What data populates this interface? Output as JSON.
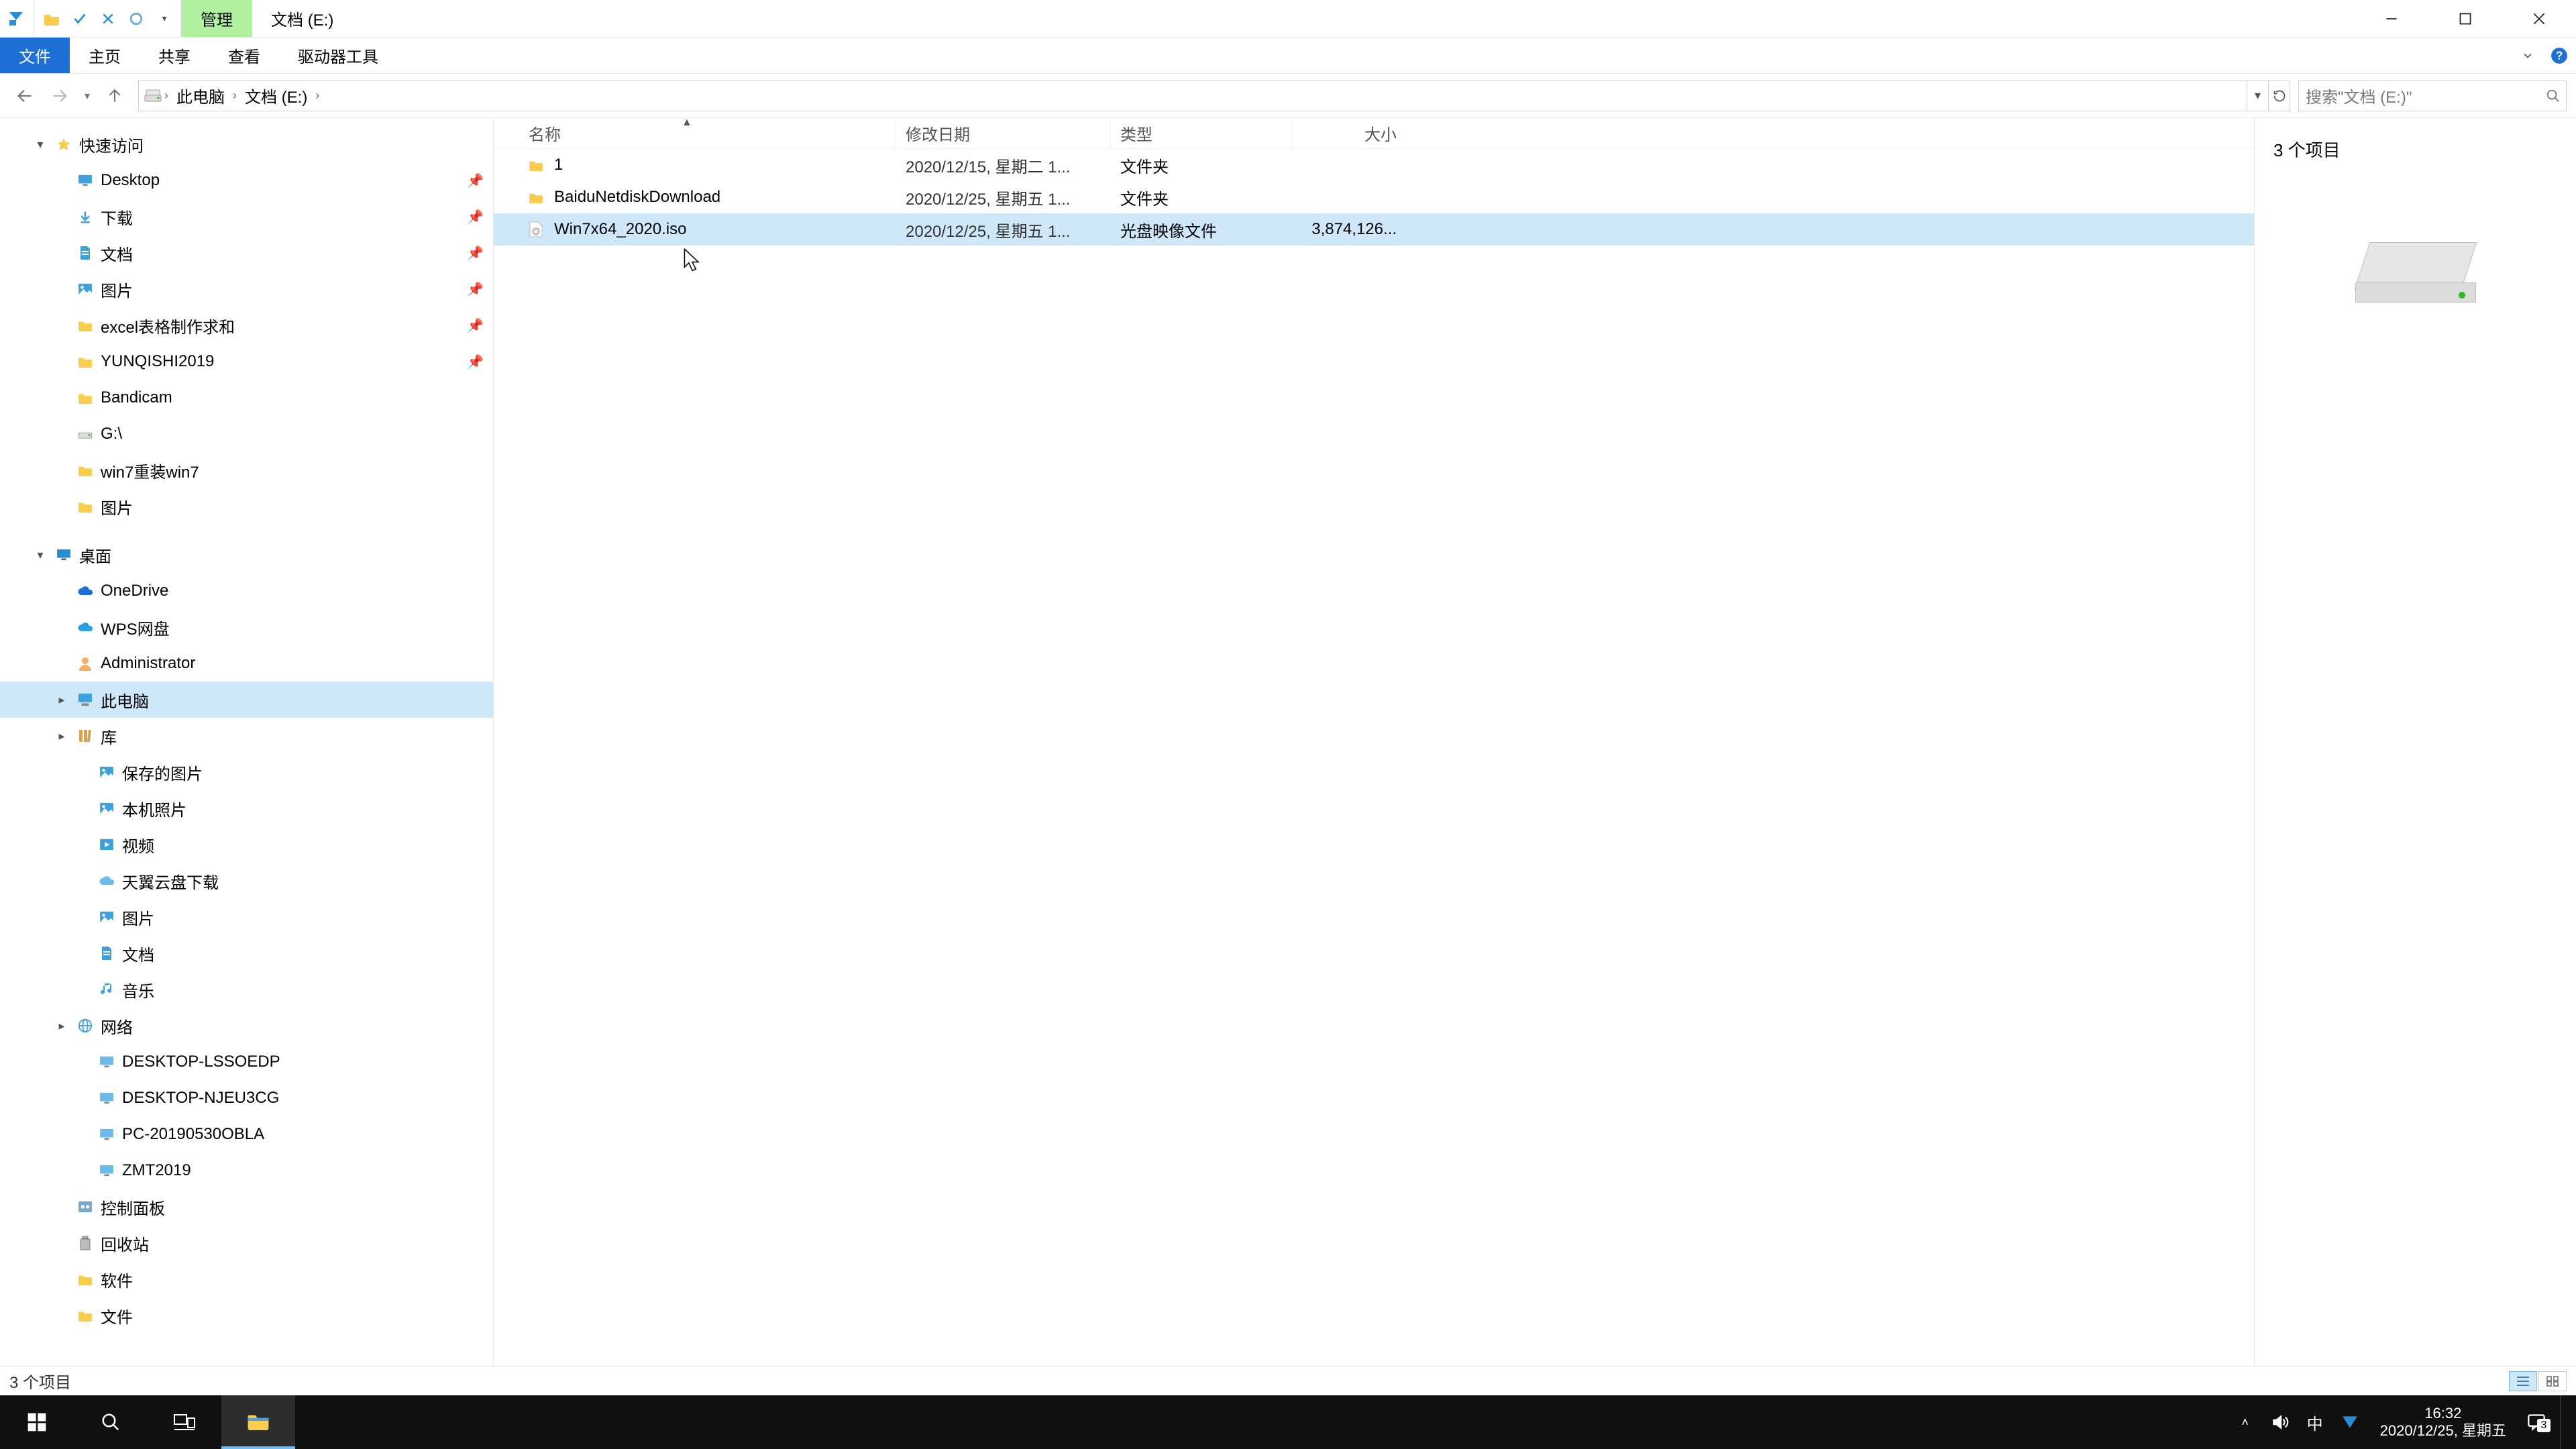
{
  "titlebar": {
    "context_tab": "管理",
    "location_tab": "文档 (E:)"
  },
  "ribbon": {
    "file": "文件",
    "home": "主页",
    "share": "共享",
    "view": "查看",
    "drive_tools": "驱动器工具"
  },
  "breadcrumb": {
    "segs": [
      "此电脑",
      "文档 (E:)"
    ]
  },
  "search": {
    "placeholder": "搜索\"文档 (E:)\""
  },
  "tree": {
    "items": [
      {
        "label": "快速访问",
        "indent": 0,
        "caret": "▾",
        "icon": "star"
      },
      {
        "label": "Desktop",
        "indent": 1,
        "icon": "desktop",
        "pin": true
      },
      {
        "label": "下载",
        "indent": 1,
        "icon": "download",
        "pin": true
      },
      {
        "label": "文档",
        "indent": 1,
        "icon": "doc",
        "pin": true
      },
      {
        "label": "图片",
        "indent": 1,
        "icon": "pic",
        "pin": true
      },
      {
        "label": "excel表格制作求和",
        "indent": 1,
        "icon": "folder",
        "pin": true
      },
      {
        "label": "YUNQISHI2019",
        "indent": 1,
        "icon": "folder",
        "pin": true
      },
      {
        "label": "Bandicam",
        "indent": 1,
        "icon": "folder"
      },
      {
        "label": "G:\\",
        "indent": 1,
        "icon": "drive"
      },
      {
        "label": "win7重装win7",
        "indent": 1,
        "icon": "folder"
      },
      {
        "label": "图片",
        "indent": 1,
        "icon": "folder"
      },
      {
        "label": "桌面",
        "indent": 0,
        "caret": "▾",
        "icon": "desktop-blue",
        "spaceBefore": true
      },
      {
        "label": "OneDrive",
        "indent": 1,
        "icon": "onedrive"
      },
      {
        "label": "WPS网盘",
        "indent": 1,
        "icon": "wps"
      },
      {
        "label": "Administrator",
        "indent": 1,
        "icon": "user"
      },
      {
        "label": "此电脑",
        "indent": 1,
        "icon": "pc",
        "active": true,
        "caret": "▸"
      },
      {
        "label": "库",
        "indent": 1,
        "icon": "lib",
        "caret": "▸"
      },
      {
        "label": "保存的图片",
        "indent": 2,
        "icon": "pic"
      },
      {
        "label": "本机照片",
        "indent": 2,
        "icon": "pic"
      },
      {
        "label": "视频",
        "indent": 2,
        "icon": "video"
      },
      {
        "label": "天翼云盘下载",
        "indent": 2,
        "icon": "cloud"
      },
      {
        "label": "图片",
        "indent": 2,
        "icon": "pic"
      },
      {
        "label": "文档",
        "indent": 2,
        "icon": "doc"
      },
      {
        "label": "音乐",
        "indent": 2,
        "icon": "music"
      },
      {
        "label": "网络",
        "indent": 1,
        "icon": "net",
        "caret": "▸"
      },
      {
        "label": "DESKTOP-LSSOEDP",
        "indent": 2,
        "icon": "netpc"
      },
      {
        "label": "DESKTOP-NJEU3CG",
        "indent": 2,
        "icon": "netpc"
      },
      {
        "label": "PC-20190530OBLA",
        "indent": 2,
        "icon": "netpc"
      },
      {
        "label": "ZMT2019",
        "indent": 2,
        "icon": "netpc"
      },
      {
        "label": "控制面板",
        "indent": 1,
        "icon": "cpl"
      },
      {
        "label": "回收站",
        "indent": 1,
        "icon": "bin"
      },
      {
        "label": "软件",
        "indent": 1,
        "icon": "folder"
      },
      {
        "label": "文件",
        "indent": 1,
        "icon": "folder"
      }
    ]
  },
  "columns": {
    "name": "名称",
    "date": "修改日期",
    "type": "类型",
    "size": "大小"
  },
  "files": [
    {
      "name": "1",
      "date": "2020/12/15, 星期二 1...",
      "type": "文件夹",
      "size": "",
      "icon": "folder"
    },
    {
      "name": "BaiduNetdiskDownload",
      "date": "2020/12/25, 星期五 1...",
      "type": "文件夹",
      "size": "",
      "icon": "folder"
    },
    {
      "name": "Win7x64_2020.iso",
      "date": "2020/12/25, 星期五 1...",
      "type": "光盘映像文件",
      "size": "3,874,126...",
      "icon": "iso",
      "selected": true
    }
  ],
  "preview": {
    "count_label": "3 个项目"
  },
  "status": {
    "text": "3 个项目"
  },
  "tray": {
    "ime": "中",
    "time": "16:32",
    "date": "2020/12/25, 星期五",
    "ac_badge": "3"
  }
}
